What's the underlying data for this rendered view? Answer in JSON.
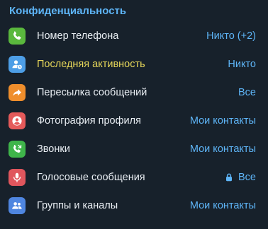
{
  "section_title": "Конфиденциальность",
  "items": [
    {
      "label": "Номер телефона",
      "value": "Никто (+2)",
      "icon": "phone-icon",
      "color": "#5ab83d",
      "highlight": false,
      "locked": false
    },
    {
      "label": "Последняя активность",
      "value": "Никто",
      "icon": "user-clock-icon",
      "color": "#4d9ee6",
      "highlight": true,
      "locked": false
    },
    {
      "label": "Пересылка сообщений",
      "value": "Все",
      "icon": "forward-icon",
      "color": "#ef8e2c",
      "highlight": false,
      "locked": false
    },
    {
      "label": "Фотография профиля",
      "value": "Мои контакты",
      "icon": "profile-photo-icon",
      "color": "#e55a5a",
      "highlight": false,
      "locked": false
    },
    {
      "label": "Звонки",
      "value": "Мои контакты",
      "icon": "call-icon",
      "color": "#3fb54a",
      "highlight": false,
      "locked": false
    },
    {
      "label": "Голосовые сообщения",
      "value": "Все",
      "icon": "microphone-icon",
      "color": "#e0565d",
      "highlight": false,
      "locked": true
    },
    {
      "label": "Группы и каналы",
      "value": "Мои контакты",
      "icon": "group-icon",
      "color": "#4f86e0",
      "highlight": false,
      "locked": false
    }
  ]
}
